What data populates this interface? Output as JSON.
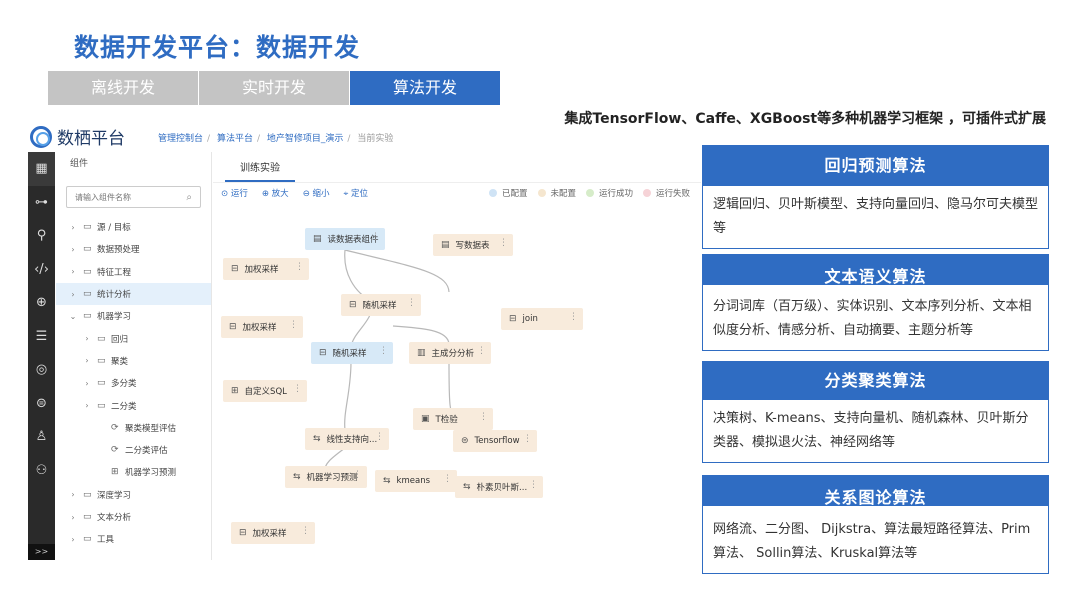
{
  "page": {
    "title": "数据开发平台：数据开发",
    "tabs": [
      "离线开发",
      "实时开发",
      "算法开发"
    ],
    "active_tab": 2,
    "subtitle": "集成TensorFlow、Caffe、XGBoost等多种机器学习框架 ，可插件式扩展"
  },
  "app": {
    "brand": "数栖平台",
    "breadcrumb": [
      "管理控制台",
      "算法平台",
      "地产智修项目_演示",
      "当前实验"
    ]
  },
  "sidebar": {
    "icons": [
      "grid-icon",
      "share-icon",
      "flow-icon",
      "code-icon",
      "robot-icon",
      "database-icon",
      "globe-icon",
      "list-icon",
      "stamp-icon",
      "users-icon"
    ],
    "more_label": ">>"
  },
  "tree": {
    "header": "组件",
    "search_placeholder": "请输入组件名称",
    "items": [
      {
        "label": "源 / 目标",
        "arrow": "›",
        "icon": "folder",
        "indent": 0
      },
      {
        "label": "数据预处理",
        "arrow": "›",
        "icon": "folder",
        "indent": 0
      },
      {
        "label": "特征工程",
        "arrow": "›",
        "icon": "folder",
        "indent": 0
      },
      {
        "label": "统计分析",
        "arrow": "›",
        "icon": "folder",
        "indent": 0,
        "selected": true
      },
      {
        "label": "机器学习",
        "arrow": "⌄",
        "icon": "folder-open",
        "indent": 0
      },
      {
        "label": "回归",
        "arrow": "›",
        "icon": "folder",
        "indent": 1
      },
      {
        "label": "聚类",
        "arrow": "›",
        "icon": "folder",
        "indent": 1
      },
      {
        "label": "多分类",
        "arrow": "›",
        "icon": "folder",
        "indent": 1
      },
      {
        "label": "二分类",
        "arrow": "›",
        "icon": "folder",
        "indent": 1
      },
      {
        "label": "聚类模型评估",
        "arrow": "",
        "icon": "eval",
        "indent": 2
      },
      {
        "label": "二分类评估",
        "arrow": "",
        "icon": "eval",
        "indent": 2
      },
      {
        "label": "机器学习预测",
        "arrow": "",
        "icon": "predict",
        "indent": 2
      },
      {
        "label": "深度学习",
        "arrow": "›",
        "icon": "folder",
        "indent": 0
      },
      {
        "label": "文本分析",
        "arrow": "›",
        "icon": "folder",
        "indent": 0
      },
      {
        "label": "工具",
        "arrow": "›",
        "icon": "folder",
        "indent": 0
      }
    ]
  },
  "canvas": {
    "tab": "训练实验",
    "toolbar": [
      {
        "label": "运行",
        "icon": "play-icon"
      },
      {
        "label": "放大",
        "icon": "zoom-in-icon"
      },
      {
        "label": "缩小",
        "icon": "zoom-out-icon"
      },
      {
        "label": "定位",
        "icon": "locate-icon"
      }
    ],
    "legend": [
      {
        "label": "已配置",
        "color": "#cfe3f5"
      },
      {
        "label": "未配置",
        "color": "#f5e6cf"
      },
      {
        "label": "运行成功",
        "color": "#d6ecc9"
      },
      {
        "label": "运行失败",
        "color": "#f6d3d7"
      }
    ],
    "nodes": [
      {
        "label": "读数据表组件",
        "style": "blue",
        "icon": "table-icon"
      },
      {
        "label": "写数据表",
        "style": "orange",
        "icon": "table-icon"
      },
      {
        "label": "加权采样",
        "style": "orange",
        "icon": "sample-icon"
      },
      {
        "label": "随机采样",
        "style": "orange",
        "icon": "sample-icon"
      },
      {
        "label": "join",
        "style": "orange",
        "icon": "sample-icon"
      },
      {
        "label": "加权采样",
        "style": "orange",
        "icon": "sample-icon"
      },
      {
        "label": "随机采样",
        "style": "blue",
        "icon": "sample-icon"
      },
      {
        "label": "主成分分析",
        "style": "orange",
        "icon": "pca-icon"
      },
      {
        "label": "自定义SQL",
        "style": "orange",
        "icon": "sql-icon"
      },
      {
        "label": "T检验",
        "style": "orange",
        "icon": "test-icon"
      },
      {
        "label": "线性支持向...",
        "style": "orange",
        "icon": "model-icon"
      },
      {
        "label": "Tensorflow",
        "style": "orange",
        "icon": "tf-icon"
      },
      {
        "label": "机器学习预测",
        "style": "orange",
        "icon": "predict-icon"
      },
      {
        "label": "kmeans",
        "style": "orange",
        "icon": "model-icon"
      },
      {
        "label": "朴素贝叶斯...",
        "style": "orange",
        "icon": "model-icon"
      },
      {
        "label": "加权采样",
        "style": "orange",
        "icon": "sample-icon"
      }
    ]
  },
  "cards": [
    {
      "title": "回归预测算法",
      "body": "逻辑回归、贝叶斯模型、支持向量回归、隐马尔可夫模型等"
    },
    {
      "title": "文本语义算法",
      "body": "分词词库（百万级）、实体识别、文本序列分析、文本相似度分析、情感分析、自动摘要、主题分析等"
    },
    {
      "title": "分类聚类算法",
      "body": "决策树、K-means、支持向量机、随机森林、贝叶斯分类器、模拟退火法、神经网络等"
    },
    {
      "title": "关系图论算法",
      "body": "网络流、二分图、 Dijkstra、算法最短路径算法、Prim算法、 Sollin算法、Kruskal算法等"
    }
  ]
}
